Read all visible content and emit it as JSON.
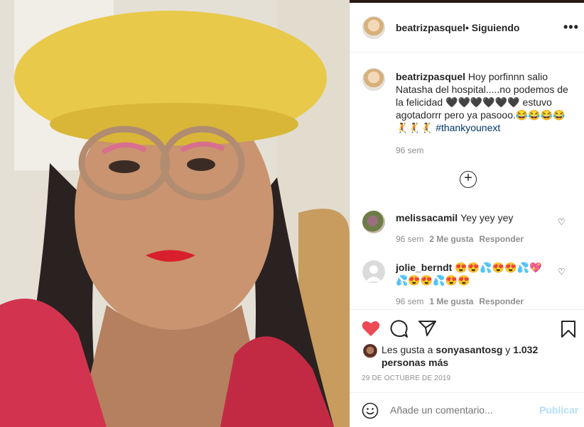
{
  "post": {
    "photo_alt": "",
    "username": "beatrizpasquel",
    "follow_sep": "•",
    "follow_status": "Siguiendo",
    "more": "•••"
  },
  "caption": {
    "username": "beatrizpasquel",
    "text_1": " Hoy porfinnn salio Natasha del hospital.....no podemos de la felicidad ",
    "hearts": "🖤🖤🖤🖤🖤🖤",
    "text_2": " estuvo agotadorrr pero ya pasooo.",
    "emoji_1": "😂😂😂😂",
    "emoji_2": " 🤾🤾🤾 ",
    "hashtag": "#thankyounext",
    "time": "96 sem"
  },
  "load_more_icon": "⊕",
  "comments": [
    {
      "username": "melissacamil",
      "text": "Yey yey yey",
      "time": "96 sem",
      "likes": "2 Me gusta",
      "reply": "Responder"
    },
    {
      "username": "jolie_berndt",
      "text": "😍😍💦😍😍💦💖💦😍😍💦😍😍",
      "time": "96 sem",
      "likes": "1 Me gusta",
      "reply": "Responder"
    }
  ],
  "likes": {
    "prefix": "Les gusta a ",
    "user": "sonyasantosg",
    "join": " y ",
    "count": "1.032 personas más"
  },
  "date": "29 DE OCTUBRE DE 2019",
  "add_comment": {
    "placeholder": "Añade un comentario...",
    "publish": "Publicar"
  },
  "colors": {
    "like_red": "#ed4956",
    "link_blue": "#00376b",
    "publish_blue": "#b2dffc"
  }
}
